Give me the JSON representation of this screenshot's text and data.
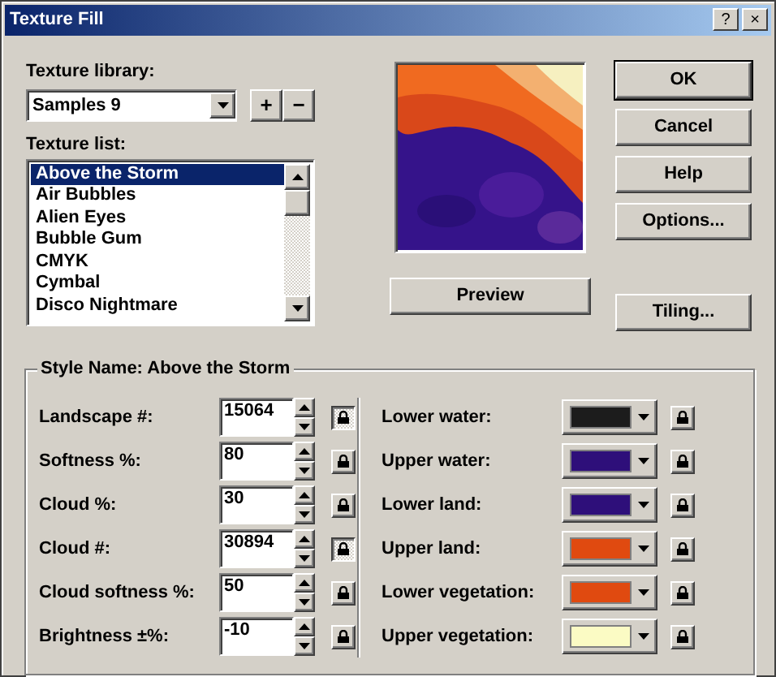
{
  "window": {
    "title": "Texture Fill",
    "title_buttons": [
      "?",
      "×"
    ]
  },
  "texture_library": {
    "label": "Texture library:",
    "value": "Samples 9",
    "add": "+",
    "remove": "−"
  },
  "texture_list": {
    "label": "Texture list:",
    "items": [
      {
        "text": "Above the Storm",
        "selected": true
      },
      {
        "text": "Air Bubbles",
        "selected": false
      },
      {
        "text": "Alien Eyes",
        "selected": false
      },
      {
        "text": "Bubble Gum",
        "selected": false
      },
      {
        "text": "CMYK",
        "selected": false
      },
      {
        "text": "Cymbal",
        "selected": false
      },
      {
        "text": "Disco Nightmare",
        "selected": false
      }
    ]
  },
  "buttons": [
    {
      "text": "OK",
      "default": true
    },
    {
      "text": "Cancel",
      "default": false
    },
    {
      "text": "Help",
      "default": false
    },
    {
      "text": "Options...",
      "default": false
    }
  ],
  "preview_button": "Preview",
  "tiling_button": "Tiling...",
  "style_group": {
    "legend": "Style Name: Above the Storm",
    "parameters": [
      {
        "label": "Landscape #:",
        "value": "15064",
        "locked": true
      },
      {
        "label": "Softness %:",
        "value": "80",
        "locked": false
      },
      {
        "label": "Cloud %:",
        "value": "30",
        "locked": false
      },
      {
        "label": "Cloud #:",
        "value": "30894",
        "locked": true
      },
      {
        "label": "Cloud softness %:",
        "value": "50",
        "locked": false
      },
      {
        "label": "Brightness ±%:",
        "value": "-10",
        "locked": false
      }
    ],
    "colors": [
      {
        "label": "Lower water:",
        "color": "#1c1c1c",
        "locked": false
      },
      {
        "label": "Upper water:",
        "color": "#2e0f7a",
        "locked": false
      },
      {
        "label": "Lower land:",
        "color": "#2e0f7a",
        "locked": false
      },
      {
        "label": "Upper land:",
        "color": "#e04a10",
        "locked": false
      },
      {
        "label": "Lower vegetation:",
        "color": "#e04a10",
        "locked": false
      },
      {
        "label": "Upper vegetation:",
        "color": "#fbfbc4",
        "locked": false
      }
    ]
  }
}
